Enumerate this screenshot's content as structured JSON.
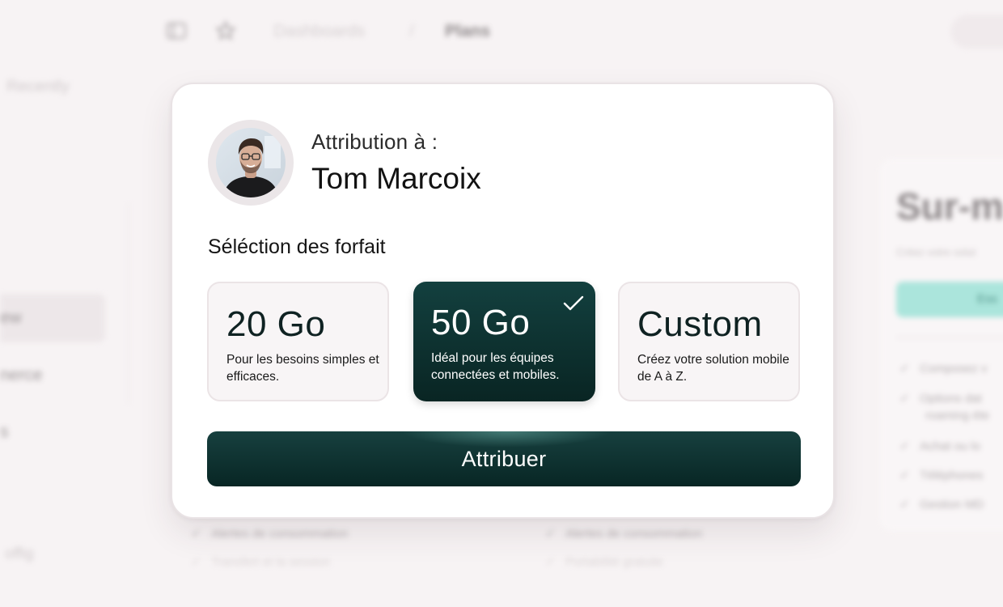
{
  "background": {
    "sidebar": {
      "recently_label": "Recently",
      "items": [
        "ew",
        "nerce",
        "s",
        "offig"
      ]
    },
    "topbar": {
      "breadcrumb": [
        "Dashboards",
        "Plans"
      ],
      "separator": "/"
    },
    "right_card": {
      "title": "Sur-m",
      "subtitle": "Créez votre solut",
      "button_label": "Ess",
      "features": [
        "Composez v",
        "Options dat",
        "roaming éte",
        "Achat ou lo",
        "Téléphones",
        "Gestion MD"
      ]
    },
    "below_features_left": [
      "Alertes de consommation",
      "Transfert et la session"
    ],
    "below_features_right": [
      "Alertes de consommation",
      "Portabilité gratuite"
    ]
  },
  "modal": {
    "assign_label": "Attribution à :",
    "user_name": "Tom Marcoix",
    "section_title": "Séléction des forfait",
    "plans": [
      {
        "amount": "20 Go",
        "description": "Pour les besoins simples et efficaces.",
        "selected": false
      },
      {
        "amount": "50 Go",
        "description": "Idéal pour les équipes connectées et mobiles.",
        "selected": true
      },
      {
        "amount": "Custom",
        "description": "Créez votre solution mobile de A à Z.",
        "selected": false
      }
    ],
    "cta_label": "Attribuer"
  },
  "colors": {
    "accent_dark": "#0f3534",
    "accent_mint": "#9ee3d8",
    "page_bg": "#f7f3f4"
  }
}
